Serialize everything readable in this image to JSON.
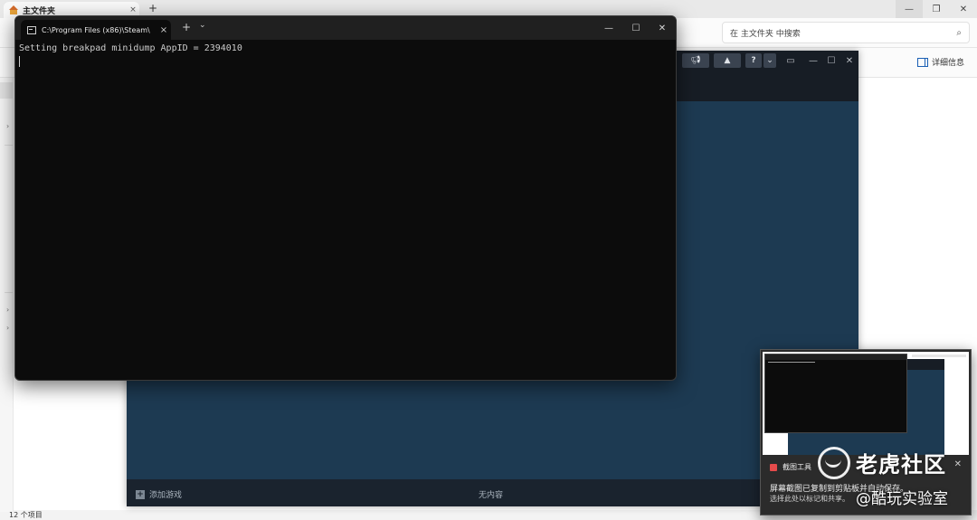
{
  "explorer": {
    "tab_title": "主文件夹",
    "tab_close": "×",
    "new_tab": "+",
    "window_buttons": [
      "—",
      "❐",
      "✕"
    ],
    "search_placeholder": "在 主文件夹 中搜索",
    "search_icon": "search-icon",
    "details_label": "详细信息",
    "sidebar_chevron": "›",
    "status": "12 个项目"
  },
  "steam": {
    "toolbar": {
      "announce_icon": "megaphone-icon",
      "bell_icon": "bell-icon",
      "help_label": "?",
      "dropdown": "⌄",
      "monitor_icon": "monitor-icon",
      "window_buttons": [
        "—",
        "☐",
        "✕"
      ]
    },
    "footer": {
      "add_game_label": "添加游戏",
      "plus": "+",
      "downloads_label": "无内容"
    }
  },
  "terminal": {
    "tab_title": "C:\\Program Files (x86)\\Steam\\",
    "tab_close": "×",
    "new_tab": "+",
    "dropdown": "⌄",
    "window_buttons": [
      "—",
      "☐",
      "✕"
    ],
    "output_line": "Setting breakpad minidump AppID = 2394010"
  },
  "notification": {
    "app_name": "截图工具",
    "more": "···",
    "close": "✕",
    "message_line1": "屏幕截图已复制到剪贴板并自动保存。",
    "message_line2": "选择此处以标记和共享。"
  },
  "watermark": {
    "line1": "老虎社区",
    "line2": "@酷玩实验室"
  }
}
